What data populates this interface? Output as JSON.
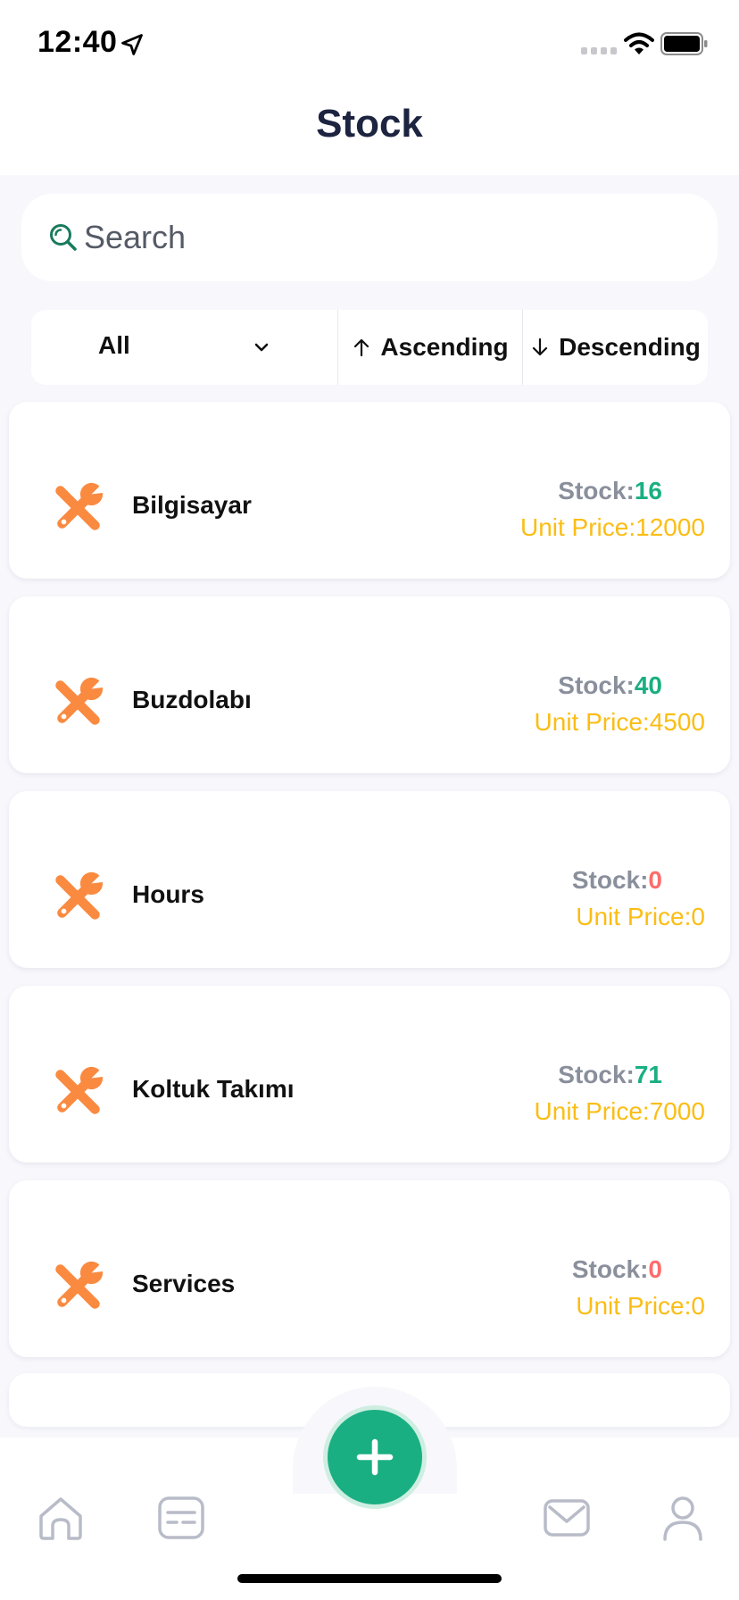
{
  "status_bar": {
    "time": "12:40"
  },
  "header": {
    "title": "Stock"
  },
  "search": {
    "placeholder": "Search"
  },
  "filter": {
    "category": "All",
    "ascending_label": "Ascending",
    "descending_label": "Descending"
  },
  "items": [
    {
      "name": "Bilgisayar",
      "stock_label": "Stock:",
      "stock": "16",
      "price_label": "Unit Price:",
      "price": "12000",
      "stock_color": "#1aaf82"
    },
    {
      "name": "Buzdolabı",
      "stock_label": "Stock:",
      "stock": "40",
      "price_label": "Unit Price:",
      "price": "4500",
      "stock_color": "#1aaf82"
    },
    {
      "name": "Hours",
      "stock_label": "Stock:",
      "stock": "0",
      "price_label": "Unit Price:",
      "price": "0",
      "stock_color": "#ff6b6b"
    },
    {
      "name": "Koltuk Takımı",
      "stock_label": "Stock:",
      "stock": "71",
      "price_label": "Unit Price:",
      "price": "7000",
      "stock_color": "#1aaf82"
    },
    {
      "name": "Services",
      "stock_label": "Stock:",
      "stock": "0",
      "price_label": "Unit Price:",
      "price": "0",
      "stock_color": "#ff6b6b"
    }
  ],
  "icons": {
    "item": "tools-icon",
    "fab": "plus-icon",
    "tabs": [
      "home-icon",
      "list-card-icon",
      "mail-icon",
      "user-icon"
    ]
  },
  "colors": {
    "accent": "#1aaf82",
    "tools": "#fa8a40",
    "price": "#fbbd14",
    "zero_stock": "#ff6b6b",
    "title": "#1c2440"
  }
}
